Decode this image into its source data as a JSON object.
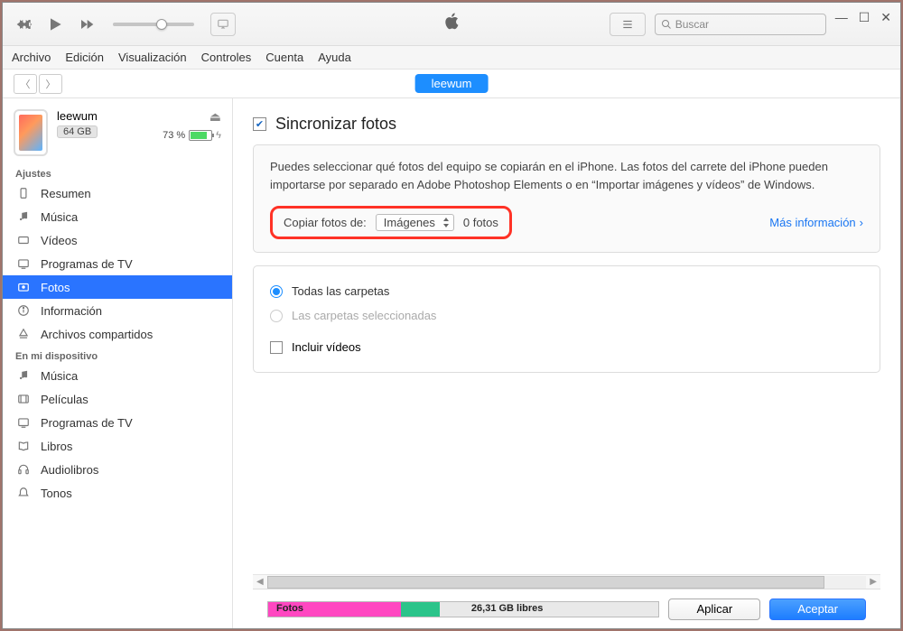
{
  "search_placeholder": "Buscar",
  "menubar": [
    "Archivo",
    "Edición",
    "Visualización",
    "Controles",
    "Cuenta",
    "Ayuda"
  ],
  "device": {
    "name": "leewum",
    "capacity": "64 GB",
    "battery_percent": "73 %"
  },
  "device_pill": "leewum",
  "sections": {
    "ajustes": {
      "label": "Ajustes",
      "items": [
        {
          "icon": "summary",
          "label": "Resumen"
        },
        {
          "icon": "music",
          "label": "Música"
        },
        {
          "icon": "video",
          "label": "Vídeos"
        },
        {
          "icon": "tv",
          "label": "Programas de TV"
        },
        {
          "icon": "photos",
          "label": "Fotos"
        },
        {
          "icon": "info",
          "label": "Información"
        },
        {
          "icon": "share",
          "label": "Archivos compartidos"
        }
      ]
    },
    "device_contents": {
      "label": "En mi dispositivo",
      "items": [
        {
          "icon": "music",
          "label": "Música"
        },
        {
          "icon": "movies",
          "label": "Películas"
        },
        {
          "icon": "tv",
          "label": "Programas de TV"
        },
        {
          "icon": "books",
          "label": "Libros"
        },
        {
          "icon": "audiobooks",
          "label": "Audiolibros"
        },
        {
          "icon": "tones",
          "label": "Tonos"
        }
      ]
    }
  },
  "main": {
    "title": "Sincronizar fotos",
    "description": "Puedes seleccionar qué fotos del equipo se copiarán en el iPhone. Las fotos del carrete del iPhone pueden importarse por separado en Adobe Photoshop Elements o en “Importar imágenes y vídeos” de Windows.",
    "copy_label": "Copiar fotos de:",
    "copy_source": "Imágenes",
    "photo_count": "0 fotos",
    "more_info": "Más información",
    "radio_all": "Todas las carpetas",
    "radio_selected": "Las carpetas seleccionadas",
    "include_videos": "Incluir vídeos"
  },
  "footer": {
    "usage": {
      "segments": [
        {
          "color": "#ff47c1",
          "width": 34,
          "label": "Fotos"
        },
        {
          "color": "#2bc48a",
          "width": 10,
          "label": ""
        },
        {
          "color": "#d9d9d9",
          "width": 56,
          "label": ""
        }
      ],
      "free_label": "26,31 GB libres"
    },
    "apply": "Aplicar",
    "accept": "Aceptar"
  }
}
